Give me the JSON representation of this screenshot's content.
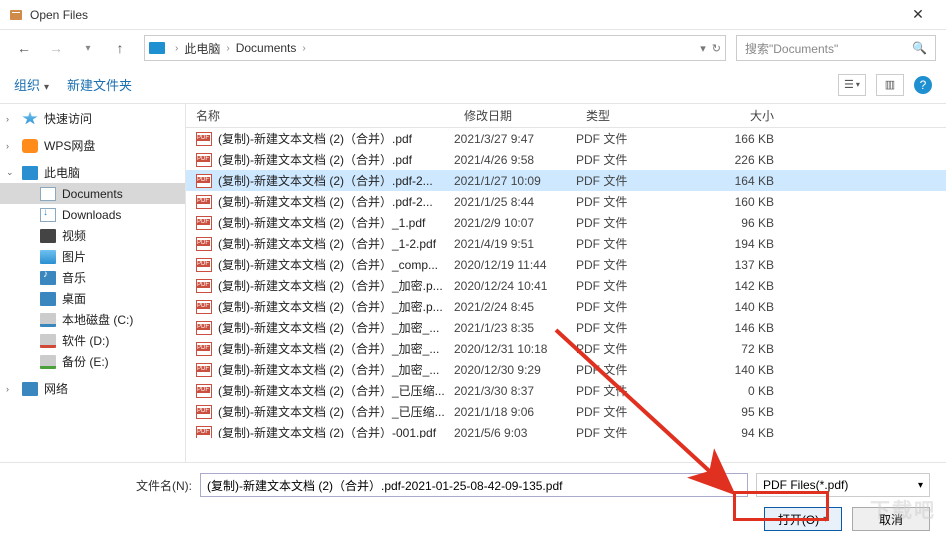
{
  "window": {
    "title": "Open Files"
  },
  "nav": {
    "breadcrumb": {
      "root": "此电脑",
      "folder": "Documents"
    },
    "search_placeholder": "搜索\"Documents\""
  },
  "toolbar": {
    "organize": "组织",
    "new_folder": "新建文件夹"
  },
  "sidebar": {
    "quick": "快速访问",
    "wps": "WPS网盘",
    "thispc": "此电脑",
    "documents": "Documents",
    "downloads": "Downloads",
    "videos": "视频",
    "pictures": "图片",
    "music": "音乐",
    "desktop": "桌面",
    "drive_c": "本地磁盘 (C:)",
    "drive_d": "软件 (D:)",
    "drive_e": "备份 (E:)",
    "network": "网络"
  },
  "columns": {
    "name": "名称",
    "date": "修改日期",
    "type": "类型",
    "size": "大小"
  },
  "files": [
    {
      "name": "(复制)-新建文本文档 (2)（合并）.pdf",
      "date": "2021/3/27 9:47",
      "type": "PDF 文件",
      "size": "166 KB"
    },
    {
      "name": "(复制)-新建文本文档 (2)（合并）.pdf",
      "date": "2021/4/26 9:58",
      "type": "PDF 文件",
      "size": "226 KB"
    },
    {
      "name": "(复制)-新建文本文档 (2)（合并）.pdf-2...",
      "date": "2021/1/27 10:09",
      "type": "PDF 文件",
      "size": "164 KB",
      "selected": true
    },
    {
      "name": "(复制)-新建文本文档 (2)（合并）.pdf-2...",
      "date": "2021/1/25 8:44",
      "type": "PDF 文件",
      "size": "160 KB"
    },
    {
      "name": "(复制)-新建文本文档 (2)（合并）_1.pdf",
      "date": "2021/2/9 10:07",
      "type": "PDF 文件",
      "size": "96 KB"
    },
    {
      "name": "(复制)-新建文本文档 (2)（合并）_1-2.pdf",
      "date": "2021/4/19 9:51",
      "type": "PDF 文件",
      "size": "194 KB"
    },
    {
      "name": "(复制)-新建文本文档 (2)（合并）_comp...",
      "date": "2020/12/19 11:44",
      "type": "PDF 文件",
      "size": "137 KB"
    },
    {
      "name": "(复制)-新建文本文档 (2)（合并）_加密.p...",
      "date": "2020/12/24 10:41",
      "type": "PDF 文件",
      "size": "142 KB"
    },
    {
      "name": "(复制)-新建文本文档 (2)（合并）_加密.p...",
      "date": "2021/2/24 8:45",
      "type": "PDF 文件",
      "size": "140 KB"
    },
    {
      "name": "(复制)-新建文本文档 (2)（合并）_加密_...",
      "date": "2021/1/23 8:35",
      "type": "PDF 文件",
      "size": "146 KB"
    },
    {
      "name": "(复制)-新建文本文档 (2)（合并）_加密_...",
      "date": "2020/12/31 10:18",
      "type": "PDF 文件",
      "size": "72 KB"
    },
    {
      "name": "(复制)-新建文本文档 (2)（合并）_加密_...",
      "date": "2020/12/30 9:29",
      "type": "PDF 文件",
      "size": "140 KB"
    },
    {
      "name": "(复制)-新建文本文档 (2)（合并）_已压缩...",
      "date": "2021/3/30 8:37",
      "type": "PDF 文件",
      "size": "0 KB"
    },
    {
      "name": "(复制)-新建文本文档 (2)（合并）_已压缩...",
      "date": "2021/1/18 9:06",
      "type": "PDF 文件",
      "size": "95 KB"
    },
    {
      "name": "(复制)-新建文本文档 (2)（合并）-001.pdf",
      "date": "2021/5/6 9:03",
      "type": "PDF 文件",
      "size": "94 KB"
    }
  ],
  "footer": {
    "filename_label": "文件名(N):",
    "filename_value": "(复制)-新建文本文档 (2)（合并）.pdf-2021-01-25-08-42-09-135.pdf",
    "filetype": "PDF Files(*.pdf)",
    "open": "打开(O)",
    "cancel": "取消"
  },
  "watermark": "下载吧"
}
